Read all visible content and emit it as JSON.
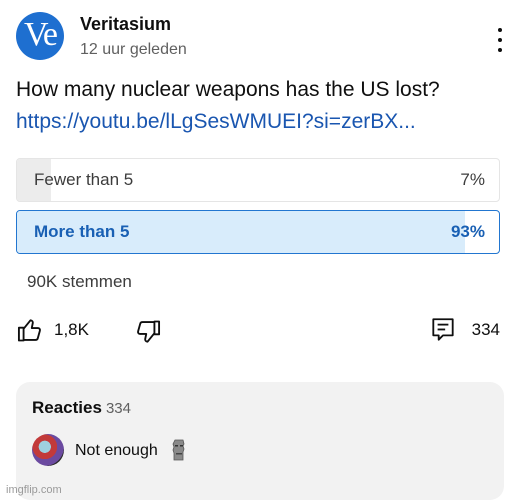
{
  "post": {
    "channel": "Veritasium",
    "avatar_text": "Ve",
    "time": "12 uur geleden",
    "question": "How many nuclear weapons has the US lost?",
    "link": "https://youtu.be/lLgSesWMUEI?si=zerBX..."
  },
  "poll": {
    "options": [
      {
        "label": "Fewer than 5",
        "percent_text": "7%",
        "percent": 7,
        "selected": false
      },
      {
        "label": "More than 5",
        "percent_text": "93%",
        "percent": 93,
        "selected": true
      }
    ],
    "votes": "90K stemmen"
  },
  "actions": {
    "likes": "1,8K",
    "comments": "334"
  },
  "comments_panel": {
    "title": "Reacties",
    "count": "334",
    "top_comment": "Not enough"
  },
  "watermark": "imgflip.com",
  "colors": {
    "accent_blue": "#2276d0",
    "link_blue": "#1a56b0",
    "selected_fill": "#d8ecfb"
  },
  "icons": [
    "more-vert-icon",
    "thumb-up-icon",
    "thumb-down-icon",
    "comment-icon",
    "moai-emoji"
  ]
}
